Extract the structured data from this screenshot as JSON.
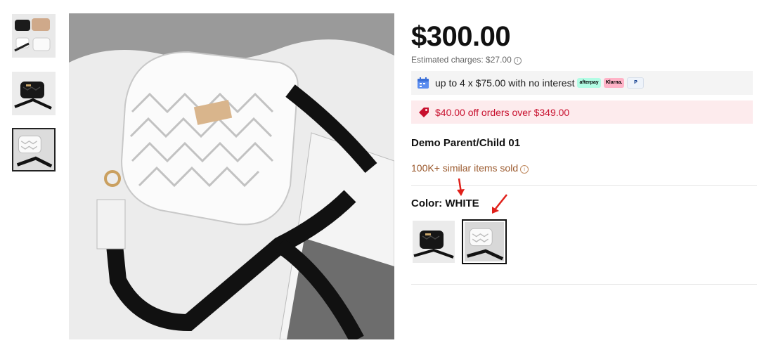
{
  "gallery": {
    "thumbnails": [
      {
        "name": "thumb-multicolor",
        "selected": false
      },
      {
        "name": "thumb-black",
        "selected": false
      },
      {
        "name": "thumb-white",
        "selected": true
      }
    ]
  },
  "product": {
    "price": "$300.00",
    "estimated_charges": "Estimated charges: $27.00",
    "installments_text": "up to 4 x $75.00 with no interest",
    "payment_providers": [
      "afterpay",
      "Klarna.",
      "P"
    ],
    "promo_text": "$40.00 off orders over $349.00",
    "title": "Demo Parent/Child 01",
    "sold_text": "100K+ similar items sold",
    "color_label": "Color: WHITE",
    "color_options": [
      {
        "name": "BLACK",
        "selected": false
      },
      {
        "name": "WHITE",
        "selected": true
      }
    ]
  },
  "colors": {
    "promo_text": "#c8102e",
    "promo_bg": "#fdebed",
    "sold_text": "#9b5a2e",
    "annotation_arrow": "#e0201a"
  }
}
